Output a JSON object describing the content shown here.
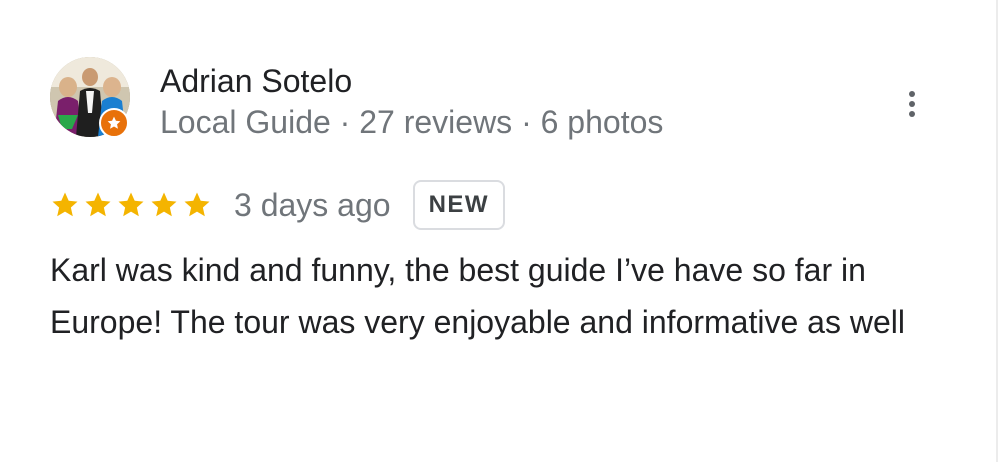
{
  "reviewer": {
    "name": "Adrian Sotelo",
    "meta": "Local Guide · 27 reviews · 6 photos",
    "badge_icon": "local-guide-star-icon",
    "badge_color": "#e8710a"
  },
  "menu": {
    "icon": "more-vertical-icon"
  },
  "review": {
    "rating": 5,
    "max_rating": 5,
    "star_color": "#f4b400",
    "date": "3 days ago",
    "badge": "NEW",
    "text": "Karl was kind and funny, the best guide I’ve have so far in Europe! The tour was very enjoyable and informative as well"
  }
}
